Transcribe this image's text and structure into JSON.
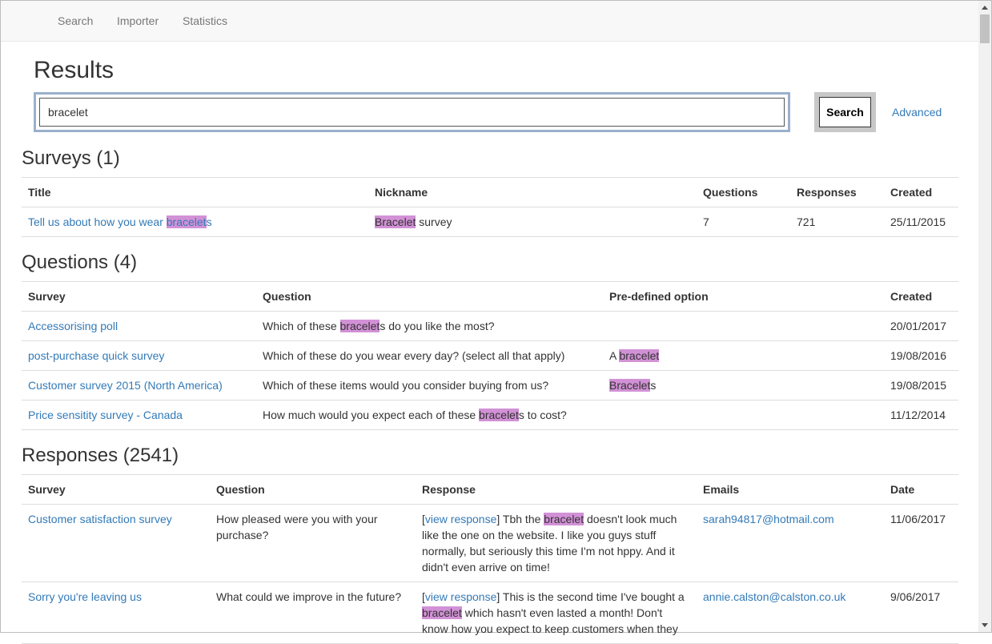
{
  "nav": {
    "items": [
      "Search",
      "Importer",
      "Statistics"
    ]
  },
  "page": {
    "title": "Results"
  },
  "search": {
    "value": "bracelet",
    "button_label": "Search",
    "advanced_label": "Advanced"
  },
  "surveys": {
    "heading": "Surveys (1)",
    "columns": [
      "Title",
      "Nickname",
      "Questions",
      "Responses",
      "Created"
    ],
    "rows": [
      {
        "title_pre": "Tell us about how you wear ",
        "title_mark": "bracelet",
        "title_post": "s",
        "nick_mark": "Bracelet",
        "nick_post": " survey",
        "questions": "7",
        "responses": "721",
        "created": "25/11/2015"
      }
    ]
  },
  "questions": {
    "heading": "Questions (4)",
    "columns": [
      "Survey",
      "Question",
      "Pre-defined option",
      "Created"
    ],
    "rows": [
      {
        "survey": "Accessorising poll",
        "q_pre": "Which of these ",
        "q_mark": "bracelet",
        "q_post": "s do you like the most?",
        "opt_pre": "",
        "opt_mark": "",
        "opt_post": "",
        "created": "20/01/2017"
      },
      {
        "survey": "post-purchase quick survey",
        "q_pre": "Which of these do you wear every day? (select all that apply)",
        "q_mark": "",
        "q_post": "",
        "opt_pre": "A ",
        "opt_mark": "bracelet",
        "opt_post": "",
        "created": "19/08/2016"
      },
      {
        "survey": "Customer survey 2015 (North America)",
        "q_pre": "Which of these items would you consider buying from us?",
        "q_mark": "",
        "q_post": "",
        "opt_pre": "",
        "opt_mark": "Bracelet",
        "opt_post": "s",
        "created": "19/08/2015"
      },
      {
        "survey": "Price sensitity survey - Canada",
        "q_pre": "How much would you expect each of these ",
        "q_mark": "bracelet",
        "q_post": "s to cost?",
        "opt_pre": "",
        "opt_mark": "",
        "opt_post": "",
        "created": "11/12/2014"
      }
    ]
  },
  "responses": {
    "heading": "Responses (2541)",
    "columns": [
      "Survey",
      "Question",
      "Response",
      "Emails",
      "Date"
    ],
    "view_label": "view response",
    "rows": [
      {
        "survey": "Customer satisfaction survey",
        "question": "How pleased were you with your purchase?",
        "r_pre": "Tbh the ",
        "r_mark": "bracelet",
        "r_post": " doesn't look much like the one on the website. I like you guys stuff normally, but seriously this time I'm not hppy. And it didn't even arrive on time!",
        "email": "sarah94817@hotmail.com",
        "date": "11/06/2017"
      },
      {
        "survey": "Sorry you're leaving us",
        "question": "What could we improve in the future?",
        "r_pre": "This is the second time I've bought a ",
        "r_mark": "bracelet",
        "r_post": " which hasn't even lasted a month! Don't know how you expect to keep customers when they",
        "email": "annie.calston@calston.co.uk",
        "date": "9/06/2017"
      }
    ]
  }
}
